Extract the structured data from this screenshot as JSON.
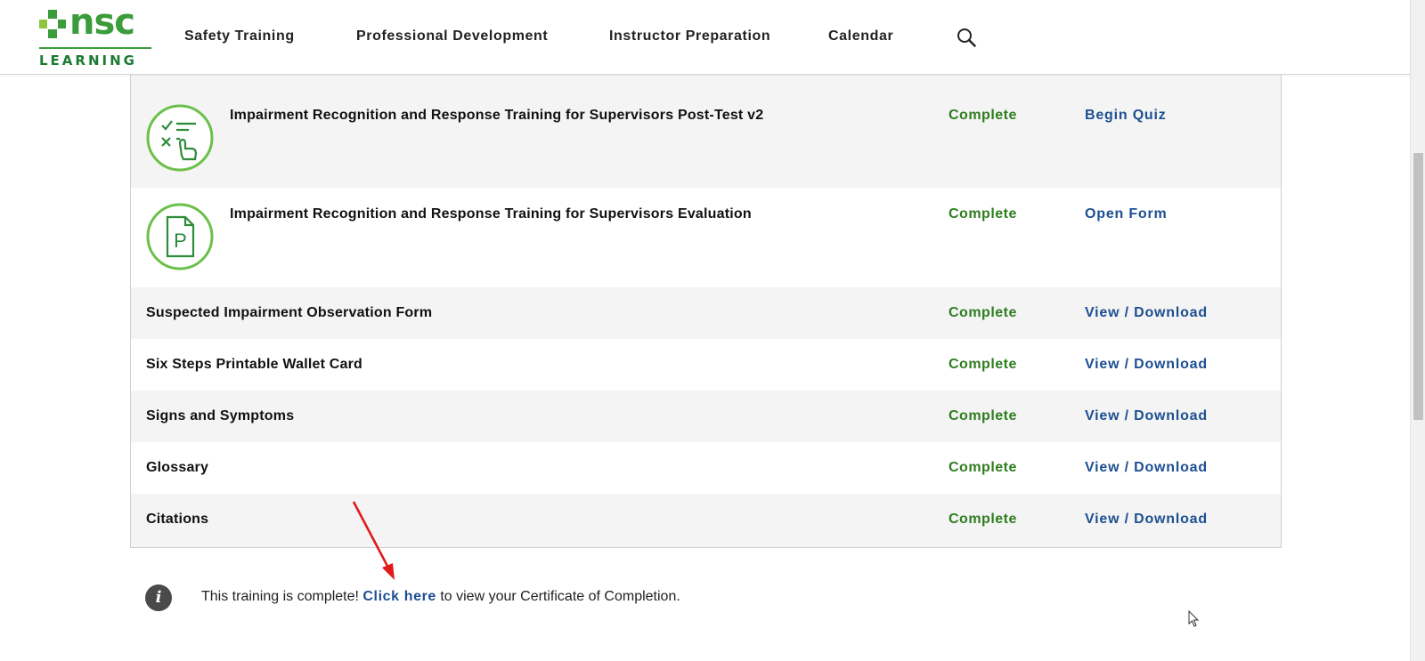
{
  "header": {
    "logo": {
      "brand": "nsc",
      "tagline": "LEARNING",
      "colors": {
        "green": "#3a9c3a",
        "dark_green": "#1d7a33",
        "light_green": "#8cc63f"
      }
    },
    "nav": [
      {
        "label": "Safety Training"
      },
      {
        "label": "Professional Development"
      },
      {
        "label": "Instructor Preparation"
      },
      {
        "label": "Calendar"
      }
    ],
    "search_icon": "magnifier-icon"
  },
  "items": [
    {
      "title": "Impairment Recognition and Response Training for Supervisors Post-Test v2",
      "status": "Complete",
      "action": "Begin Quiz",
      "icon": "quiz-icon"
    },
    {
      "title": "Impairment Recognition and Response Training for Supervisors Evaluation",
      "status": "Complete",
      "action": "Open Form",
      "icon": "form-document-icon"
    },
    {
      "title": "Suspected Impairment Observation Form",
      "status": "Complete",
      "action": "View / Download"
    },
    {
      "title": "Six Steps Printable Wallet Card",
      "status": "Complete",
      "action": "View / Download"
    },
    {
      "title": "Signs and Symptoms",
      "status": "Complete",
      "action": "View / Download"
    },
    {
      "title": "Glossary",
      "status": "Complete",
      "action": "View / Download"
    },
    {
      "title": "Citations",
      "status": "Complete",
      "action": "View / Download"
    }
  ],
  "notice": {
    "icon": "info-icon",
    "prefix": "This training is complete! ",
    "link": "Click here",
    "suffix": " to view your Certificate of Completion."
  },
  "colors": {
    "status": "#2e7d1f",
    "link": "#1d4f91",
    "row_alt": "#f4f4f4",
    "annotation_arrow": "#e01a1a"
  }
}
